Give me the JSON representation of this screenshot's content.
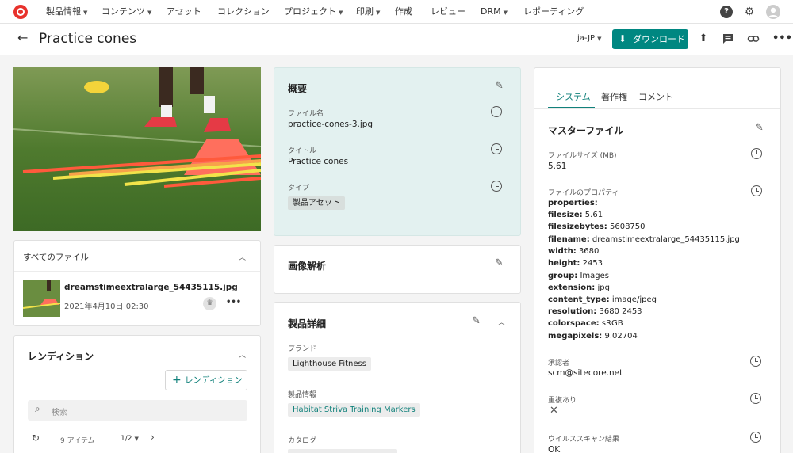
{
  "nav": {
    "items": [
      {
        "label": "製品情報",
        "caret": true
      },
      {
        "label": "コンテンツ",
        "caret": true
      },
      {
        "label": "アセット",
        "caret": false
      },
      {
        "label": "コレクション",
        "caret": false
      },
      {
        "label": "プロジェクト",
        "caret": true
      },
      {
        "label": "印刷",
        "caret": true
      },
      {
        "label": "作成",
        "caret": false
      },
      {
        "label": "レビュー",
        "caret": false
      },
      {
        "label": "DRM",
        "caret": true
      },
      {
        "label": "レポーティング",
        "caret": false
      }
    ],
    "icons": [
      "help-icon",
      "gear-icon",
      "avatar"
    ]
  },
  "header": {
    "title": "Practice cones",
    "language": "ja-JP",
    "download_label": "ダウンロード"
  },
  "files": {
    "title": "すべてのファイル",
    "file_name": "dreamstimeextralarge_54435115.jpg",
    "file_date": "2021年4月10日 02:30"
  },
  "renditions": {
    "title": "レンディション",
    "add_label": "レンディション",
    "search_placeholder": "検索",
    "count": "9 アイテム",
    "page": "1/2"
  },
  "overview": {
    "title": "概要",
    "fields": [
      {
        "label": "ファイル名",
        "value": "practice-cones-3.jpg"
      },
      {
        "label": "タイトル",
        "value": "Practice cones"
      },
      {
        "label": "タイプ",
        "value": "製品アセット"
      }
    ]
  },
  "image_analysis": {
    "title": "画像解析"
  },
  "product_details": {
    "title": "製品詳細",
    "brand_label": "ブランド",
    "brand_value": "Lighthouse Fitness",
    "product_label": "製品情報",
    "product_value": "Habitat Striva Training Markers",
    "catalog_label": "カタログ"
  },
  "right": {
    "tabs": [
      "システム",
      "著作権",
      "コメント"
    ],
    "master_title": "マスターファイル",
    "filesize_label": "ファイルサイズ (MB)",
    "filesize_value": "5.61",
    "props_label": "ファイルのプロパティ",
    "props_header": "properties:",
    "props": [
      {
        "k": "filesize:",
        "v": "5.61"
      },
      {
        "k": "filesizebytes:",
        "v": "5608750"
      },
      {
        "k": "filename:",
        "v": "dreamstimeextralarge_54435115.jpg"
      },
      {
        "k": "width:",
        "v": "3680"
      },
      {
        "k": "height:",
        "v": "2453"
      },
      {
        "k": "group:",
        "v": "Images"
      },
      {
        "k": "extension:",
        "v": "jpg"
      },
      {
        "k": "content_type:",
        "v": "image/jpeg"
      },
      {
        "k": "resolution:",
        "v": "3680 2453"
      },
      {
        "k": "colorspace:",
        "v": "sRGB"
      },
      {
        "k": "megapixels:",
        "v": "9.02704"
      }
    ],
    "approver_label": "承認者",
    "approver_value": "scm@sitecore.net",
    "duplicate_label": "重複あり",
    "virus_label": "ウイルススキャン結果",
    "virus_value": "OK"
  },
  "colors": {
    "accent": "#008781",
    "overview_bg": "#e3f1f0"
  }
}
